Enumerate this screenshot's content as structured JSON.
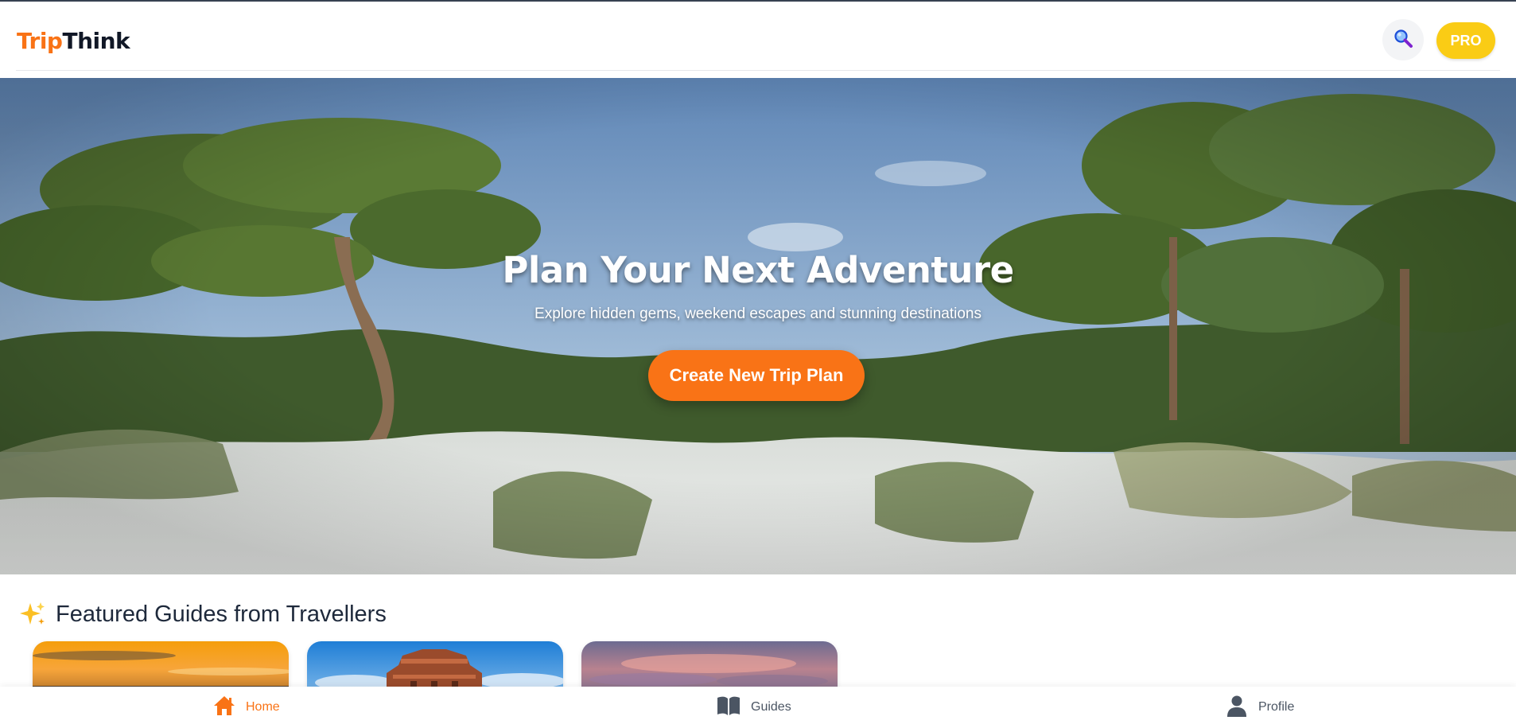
{
  "header": {
    "logo_part1": "Trip",
    "logo_part2": "Think",
    "search_icon": "magnifier-icon",
    "pro_label": "PRO"
  },
  "hero": {
    "title": "Plan Your Next Adventure",
    "subtitle": "Explore hidden gems, weekend escapes and stunning destinations",
    "cta_label": "Create New Trip Plan"
  },
  "featured": {
    "icon": "sparkles-icon",
    "title": "Featured Guides from Travellers",
    "cards": [
      {
        "image": "sunset-sky-image"
      },
      {
        "image": "stone-temple-image"
      },
      {
        "image": "dusk-clouds-image"
      }
    ]
  },
  "bottom_nav": {
    "items": [
      {
        "label": "Home",
        "icon": "home-icon",
        "active": true
      },
      {
        "label": "Guides",
        "icon": "book-icon",
        "active": false
      },
      {
        "label": "Profile",
        "icon": "user-icon",
        "active": false
      }
    ]
  },
  "colors": {
    "brand": "#f97316",
    "pro": "#facc15",
    "text_dark": "#1e293b",
    "nav_inactive": "#4b5563"
  }
}
